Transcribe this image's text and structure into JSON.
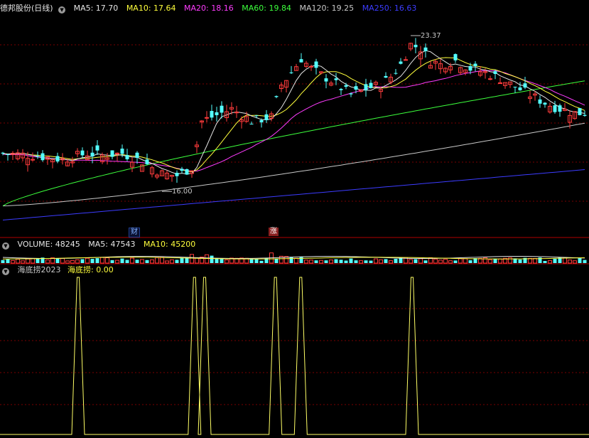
{
  "main_header": {
    "stock": "德邦股份(日线)",
    "ma5": "MA5: 17.70",
    "ma10": "MA10: 17.64",
    "ma20": "MA20: 18.16",
    "ma60": "MA60: 19.84",
    "ma120": "MA120: 19.25",
    "ma250": "MA250: 16.63"
  },
  "volume_header": {
    "label": "VOLUME: 48245",
    "ma5": "MA5: 47543",
    "ma10": "MA10: 45200"
  },
  "indicator_header": {
    "name": "海底捞2023",
    "value": "海底捞: 0.00"
  },
  "annotations": {
    "high_label": "23.37",
    "low_label": "16.00",
    "tag_cai": "财",
    "tag_zhang": "涨"
  },
  "colors": {
    "up": "#ff3c3c",
    "down": "#54ffff",
    "ma5": "#e6e6e6",
    "ma10": "#ffff3c",
    "ma20": "#ff3cff",
    "ma60": "#3cff3c",
    "ma120": "#c8c8c8",
    "ma250": "#3c3cff",
    "grid": "#7a0000",
    "indicator": "#ffff66"
  },
  "chart_data": {
    "type": "candlestick",
    "price_range": [
      14.0,
      24.5
    ],
    "high": 23.37,
    "low": 16.0,
    "signal_peaks_bar_index": [
      15,
      38,
      40,
      54,
      59,
      81
    ],
    "indicator_range": [
      0,
      1
    ],
    "indicator_current": 0.0
  }
}
